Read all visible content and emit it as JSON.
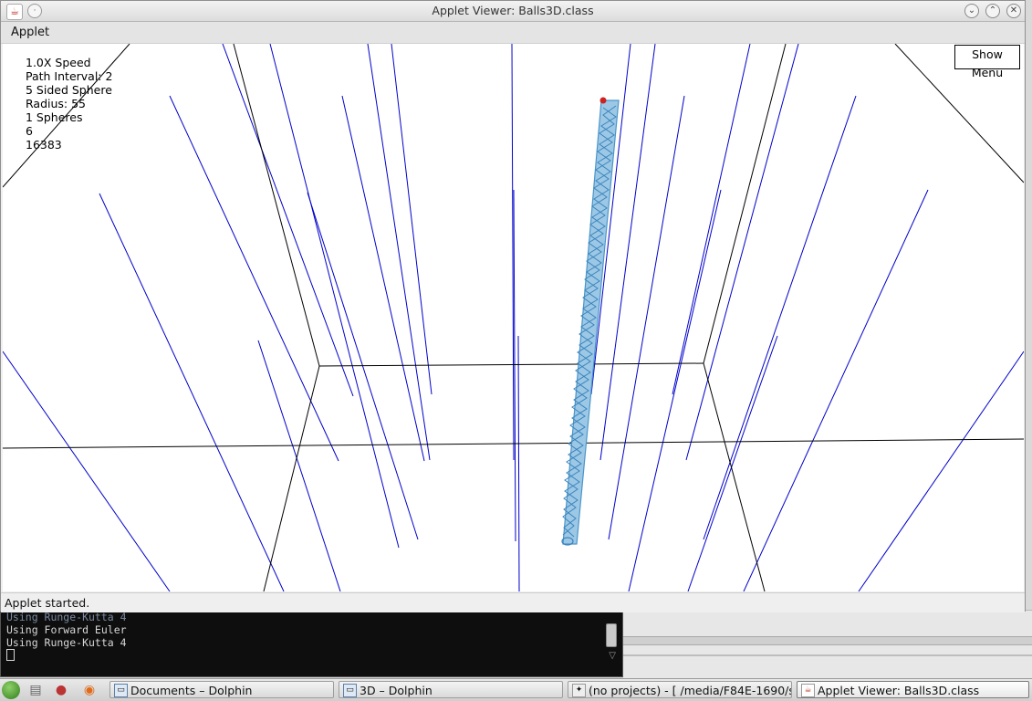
{
  "window": {
    "title": "Applet Viewer: Balls3D.class",
    "menu_label": "Applet",
    "status_text": "Applet started.",
    "buttons": [
      "minimize-icon",
      "maximize-icon",
      "close-icon"
    ]
  },
  "applet": {
    "show_menu_label": "Show Menu",
    "hud": {
      "speed": "1.0X Speed",
      "path_interval": "Path Interval: 2",
      "sphere": "5 Sided Sphere",
      "radius": "Radius: 55",
      "spheres": "1 Spheres",
      "line6": "6",
      "line7": "16383"
    }
  },
  "terminal": {
    "line1": "Using Runge-Kutta 4",
    "line2": "Using Forward Euler",
    "line3": "Using Runge-Kutta 4"
  },
  "taskbar": {
    "tasks": [
      {
        "label": "Documents – Dolphin",
        "icon": "folder-icon"
      },
      {
        "label": "3D – Dolphin",
        "icon": "folder-icon"
      },
      {
        "label": "(no projects) - [ /media/F84E-1690/s",
        "icon": "ide-icon"
      },
      {
        "label": "Applet Viewer: Balls3D.class",
        "icon": "java-icon"
      }
    ]
  },
  "colors": {
    "background_line": "#0000cc",
    "box_line": "#000000",
    "trail": "#4a95c9",
    "ball": "#cc2222"
  }
}
